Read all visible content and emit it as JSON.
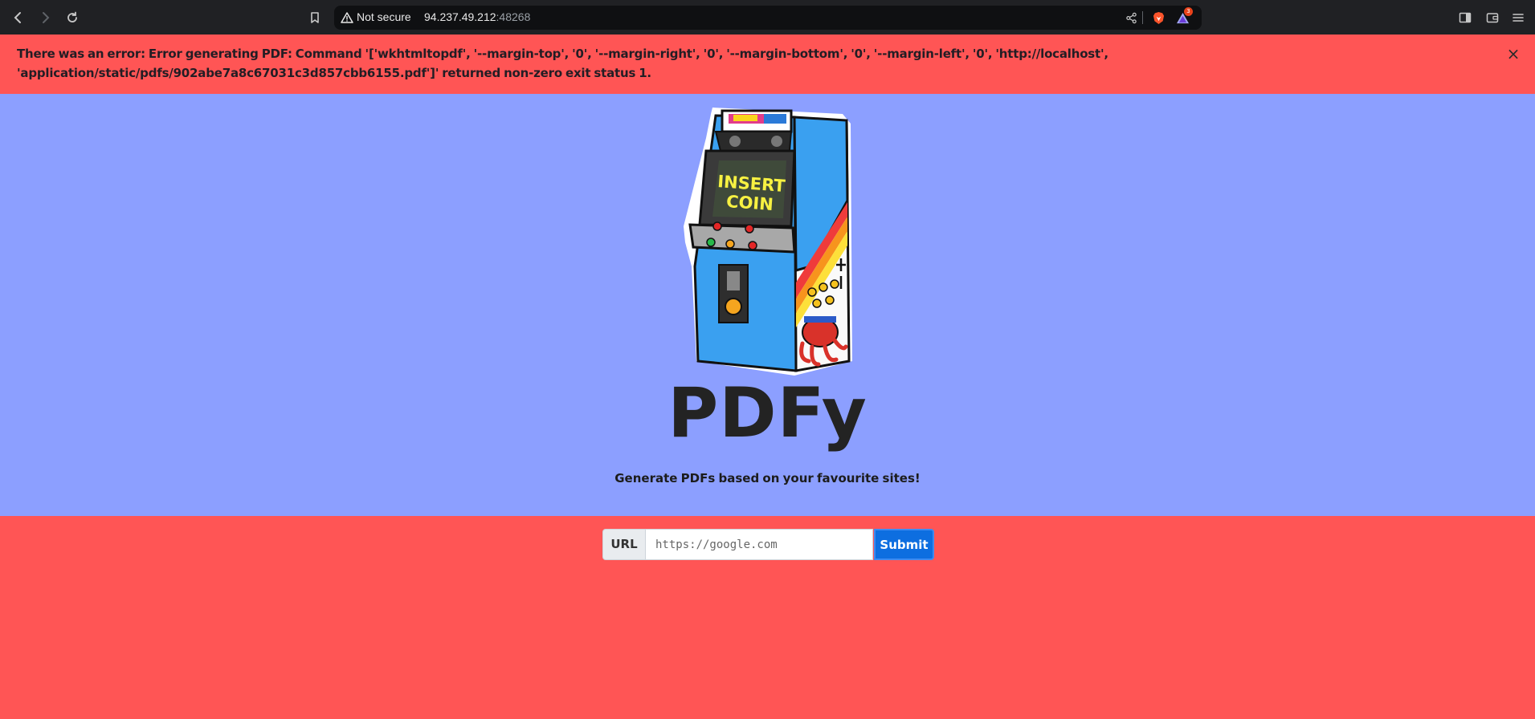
{
  "browser": {
    "back_icon": "chevron-left-icon",
    "forward_icon": "chevron-right-icon",
    "reload_icon": "reload-icon",
    "bookmark_icon": "bookmark-icon",
    "security_label": "Not secure",
    "url_host": "94.237.49.212",
    "url_port": ":48268",
    "brave_badge_count": "3"
  },
  "error": {
    "message": "There was an error: Error generating PDF: Command '['wkhtmltopdf', '--margin-top', '0', '--margin-right', '0', '--margin-bottom', '0', '--margin-left', '0', 'http://localhost', 'application/static/pdfs/902abe7a8c67031c3d857cbb6155.pdf']' returned non-zero exit status 1.",
    "close_label": "×"
  },
  "hero": {
    "title": "PDFy",
    "subtitle": "Generate PDFs based on your favourite sites!",
    "arcade_screen_line1": "INSERT",
    "arcade_screen_line2": "COIN"
  },
  "form": {
    "label": "URL",
    "placeholder": "https://google.com",
    "submit_label": "Submit"
  },
  "colors": {
    "error_bg": "#ff5555",
    "hero_bg": "#8c9fff",
    "submit_bg": "#0d6ee0"
  }
}
